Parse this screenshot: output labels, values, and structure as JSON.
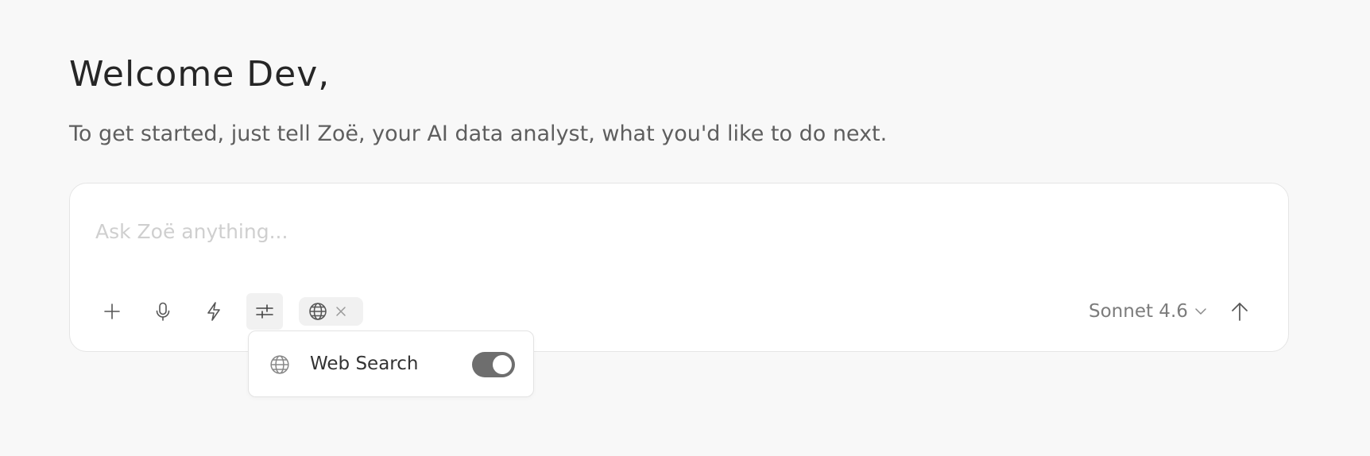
{
  "header": {
    "greeting": "Welcome Dev,",
    "subtitle": "To get started, just tell Zoë, your AI data analyst, what you'd like to do next."
  },
  "composer": {
    "placeholder": "Ask Zoë anything...",
    "value": "",
    "toolbar": {
      "add_icon": "plus-icon",
      "mic_icon": "microphone-icon",
      "quick_icon": "lightning-icon",
      "settings_icon": "sliders-icon",
      "active_tool_chip": {
        "icon": "globe-icon",
        "remove_icon": "close-icon"
      }
    },
    "model": {
      "label": "Sonnet 4.6",
      "icon": "chevron-down-icon"
    },
    "send_icon": "arrow-up-icon"
  },
  "tools_popover": {
    "items": [
      {
        "label": "Web Search",
        "icon": "globe-icon",
        "enabled": true
      }
    ]
  },
  "colors": {
    "background": "#f8f8f8",
    "card": "#ffffff",
    "border": "#e5e5e5",
    "toggle_on": "#6e6e6e",
    "chip_bg": "#f1f1f1"
  }
}
